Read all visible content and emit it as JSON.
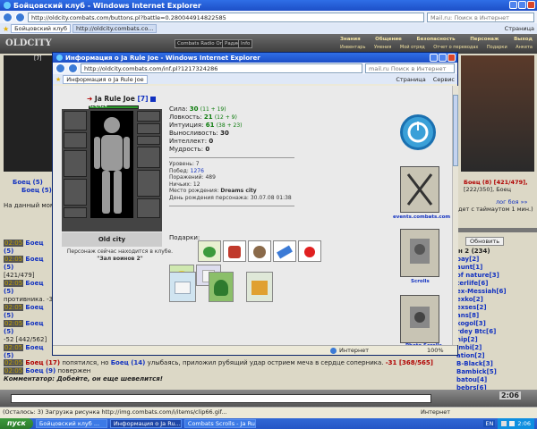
{
  "main_window": {
    "title": "Бойцовский клуб - Windows Internet Explorer",
    "url": "http://oldcity.combats.com/buttons.pl?battle=0.280044914822585",
    "search_placeholder": "Mail.ru: Поиск в Интернет",
    "tabs": [
      "Бойцовский клуб",
      "http://oldcity.combats.co..."
    ],
    "toolbar_right": "Страница",
    "logo": "OLDCITY",
    "game_buttons": [
      "Combats Radio Online",
      "Радио",
      "Info"
    ],
    "top_menu_row1": [
      "Знания",
      "Общение",
      "Безопасность",
      "Персонаж",
      "Выход"
    ],
    "top_menu_row2": [
      "Инвентарь",
      "Умения",
      "Мой отряд",
      "Отчет о переводах",
      "Подарки",
      "Анкета"
    ],
    "status": "(Осталось: 3) Загрузка рисунка http://img.combats.com/i/items/clip66.gif...",
    "status_right": "Интернет"
  },
  "left_panel": {
    "level": "[7]",
    "lines": [
      "Боец (5)",
      "Боец (5)",
      "На данный моме"
    ],
    "hp": "[421/479]"
  },
  "right_panel": {
    "fighters": "Боец (8) [421/479],",
    "fighters2": "[222/350], Боец",
    "timeout": "дет с таймаутом 1 мин.)",
    "log_label": "лог боя »»",
    "refresh_button": "Обновить",
    "room": "н 2 (234)",
    "players": [
      "bay[2]",
      "aunt[1]",
      "of nature[3]",
      "terlife[6]",
      "ex-Messiah[6]",
      "exko[2]",
      "exses[2]",
      "ans[8]",
      "kogol[3]",
      "rdey Btc[6]",
      "hip[2]",
      "imbi[2]",
      "ation[2]",
      "B-Black[3]",
      "Bambick[5]",
      "batou[4]",
      "bebrs[6]"
    ]
  },
  "combat_log": [
    {
      "time": "02:05",
      "text": "Боец (5)"
    },
    {
      "time": "02:05",
      "text": "Боец (5)"
    },
    {
      "time": "",
      "text": "[421/479]"
    },
    {
      "time": "02:05",
      "text": "Боец (5)"
    },
    {
      "time": "",
      "text": "противника. -3"
    },
    {
      "time": "02:05",
      "text": "Боец (5)"
    },
    {
      "time": "02:05",
      "text": "Боец (5)"
    },
    {
      "time": "",
      "text": "-52 [442/562]"
    },
    {
      "time": "02:05",
      "text": "Боец (5)"
    },
    {
      "time": "02:05",
      "text": "Боец (17)",
      "rest": "попятился, но",
      "name2": "Боец (14)",
      "rest2": "улыбаясь, приложил рубящий удар острием меча в сердце соперника.",
      "dmg": "-31 [368/565]"
    },
    {
      "time": "02:05",
      "text": "Боец (9)",
      "rest": "повержен"
    }
  ],
  "comment": "Комментатор: Добейте, он еще шевелится!",
  "popup": {
    "title": "Информация о Ja Rule Joe - Windows Internet Explorer",
    "url": "http://oldcity.combats.com/inf.pl?1217324286",
    "search_placeholder": "mail.ru Поиск в Интернет",
    "tab": "Информация о Ja Rule Joe",
    "toolbar_right": "Страница",
    "toolbar_right2": "Сервис",
    "character": {
      "name": "Ja Rule Joe",
      "level": "[7]",
      "hp": "424/424",
      "city": "Old city",
      "location_note": "Персонаж сейчас находится в клубе.",
      "room": "\"Зал воинов 2\""
    },
    "stats": [
      {
        "label": "Сила:",
        "value": "30",
        "extra": "(11 + 19)"
      },
      {
        "label": "Ловкость:",
        "value": "21",
        "extra": "(12 + 9)"
      },
      {
        "label": "Интуиция:",
        "value": "61",
        "extra": "(38 + 23)"
      },
      {
        "label": "Выносливость:",
        "value": "30",
        "extra": ""
      },
      {
        "label": "Интеллект:",
        "value": "0",
        "extra": ""
      },
      {
        "label": "Мудрость:",
        "value": "0",
        "extra": ""
      }
    ],
    "info": [
      {
        "label": "Уровень:",
        "value": "7"
      },
      {
        "label": "Побед:",
        "value": "1276"
      },
      {
        "label": "Поражений:",
        "value": "489"
      },
      {
        "label": "Ничьих:",
        "value": "12"
      },
      {
        "label": "Место рождения:",
        "value": "Dreams city"
      },
      {
        "label": "День рождения персонажа:",
        "value": "30.07.08 01:38"
      }
    ],
    "gifts_label": "Подарки:",
    "side_links": [
      "events.combats.com",
      "Scrolls",
      "Photo Scrolls"
    ],
    "status_right": "Интернет",
    "zoom": "100%"
  },
  "taskbar": {
    "start": "пуск",
    "buttons": [
      "Бойцовский клуб ...",
      "Информация о Ja Ru...",
      "Combats Scrolls - Ja Rul..."
    ],
    "lang": "EN",
    "clock": "2:06"
  },
  "colors": {
    "accent": "#0a7a0a",
    "link": "#1030c0",
    "danger": "#b00000"
  }
}
